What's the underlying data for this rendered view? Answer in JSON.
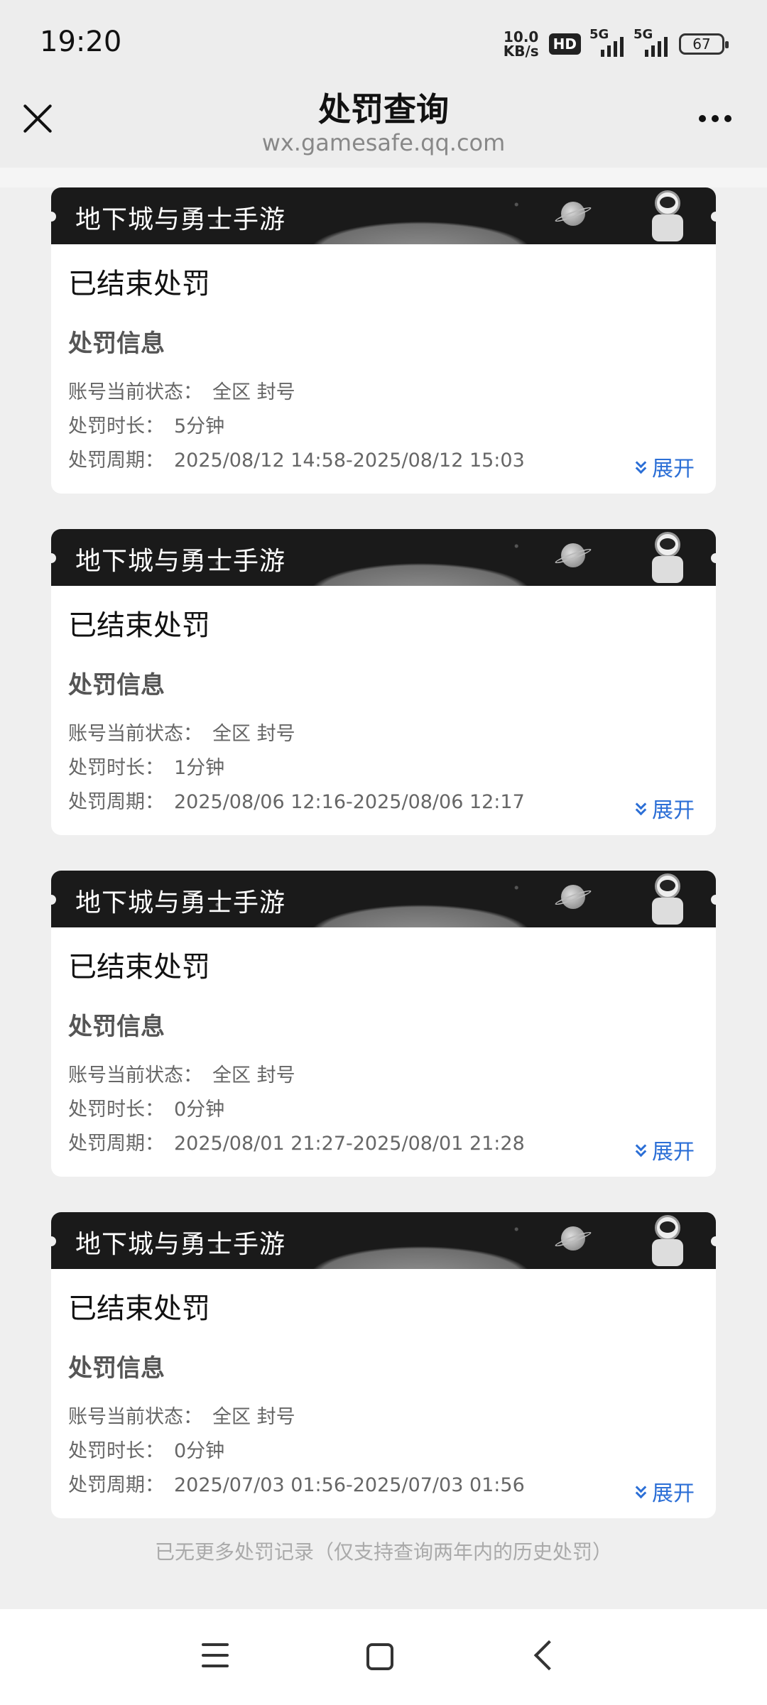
{
  "status_bar": {
    "time": "19:20",
    "net_speed_value": "10.0",
    "net_speed_unit": "KB/s",
    "hd_label": "HD",
    "signal1_label": "5G",
    "signal2_label": "5G",
    "battery": "67"
  },
  "header": {
    "title": "处罚查询",
    "subtitle": "wx.gamesafe.qq.com"
  },
  "cards": [
    {
      "game": "地下城与勇士手游",
      "status": "已结束处罚",
      "section": "处罚信息",
      "account_label": "账号当前状态：",
      "account_value": "全区 封号",
      "duration_label": "处罚时长：",
      "duration_value": "5分钟",
      "period_label": "处罚周期：",
      "period_value": "2025/08/12 14:58-2025/08/12 15:03",
      "expand": "展开"
    },
    {
      "game": "地下城与勇士手游",
      "status": "已结束处罚",
      "section": "处罚信息",
      "account_label": "账号当前状态：",
      "account_value": "全区 封号",
      "duration_label": "处罚时长：",
      "duration_value": "1分钟",
      "period_label": "处罚周期：",
      "period_value": "2025/08/06 12:16-2025/08/06 12:17",
      "expand": "展开"
    },
    {
      "game": "地下城与勇士手游",
      "status": "已结束处罚",
      "section": "处罚信息",
      "account_label": "账号当前状态：",
      "account_value": "全区 封号",
      "duration_label": "处罚时长：",
      "duration_value": "0分钟",
      "period_label": "处罚周期：",
      "period_value": "2025/08/01 21:27-2025/08/01 21:28",
      "expand": "展开"
    },
    {
      "game": "地下城与勇士手游",
      "status": "已结束处罚",
      "section": "处罚信息",
      "account_label": "账号当前状态：",
      "account_value": "全区 封号",
      "duration_label": "处罚时长：",
      "duration_value": "0分钟",
      "period_label": "处罚周期：",
      "period_value": "2025/07/03 01:56-2025/07/03 01:56",
      "expand": "展开"
    }
  ],
  "footer_note": "已无更多处罚记录（仅支持查询两年内的历史处罚）",
  "icons": {
    "close": "close-icon",
    "more": "more-icon",
    "expand": "chevron-double-down-icon",
    "nav_menu": "menu-icon",
    "nav_home": "home-icon",
    "nav_back": "back-icon"
  },
  "colors": {
    "accent": "#2c6fd6",
    "background": "#efefef",
    "banner": "#1a1a1a"
  }
}
